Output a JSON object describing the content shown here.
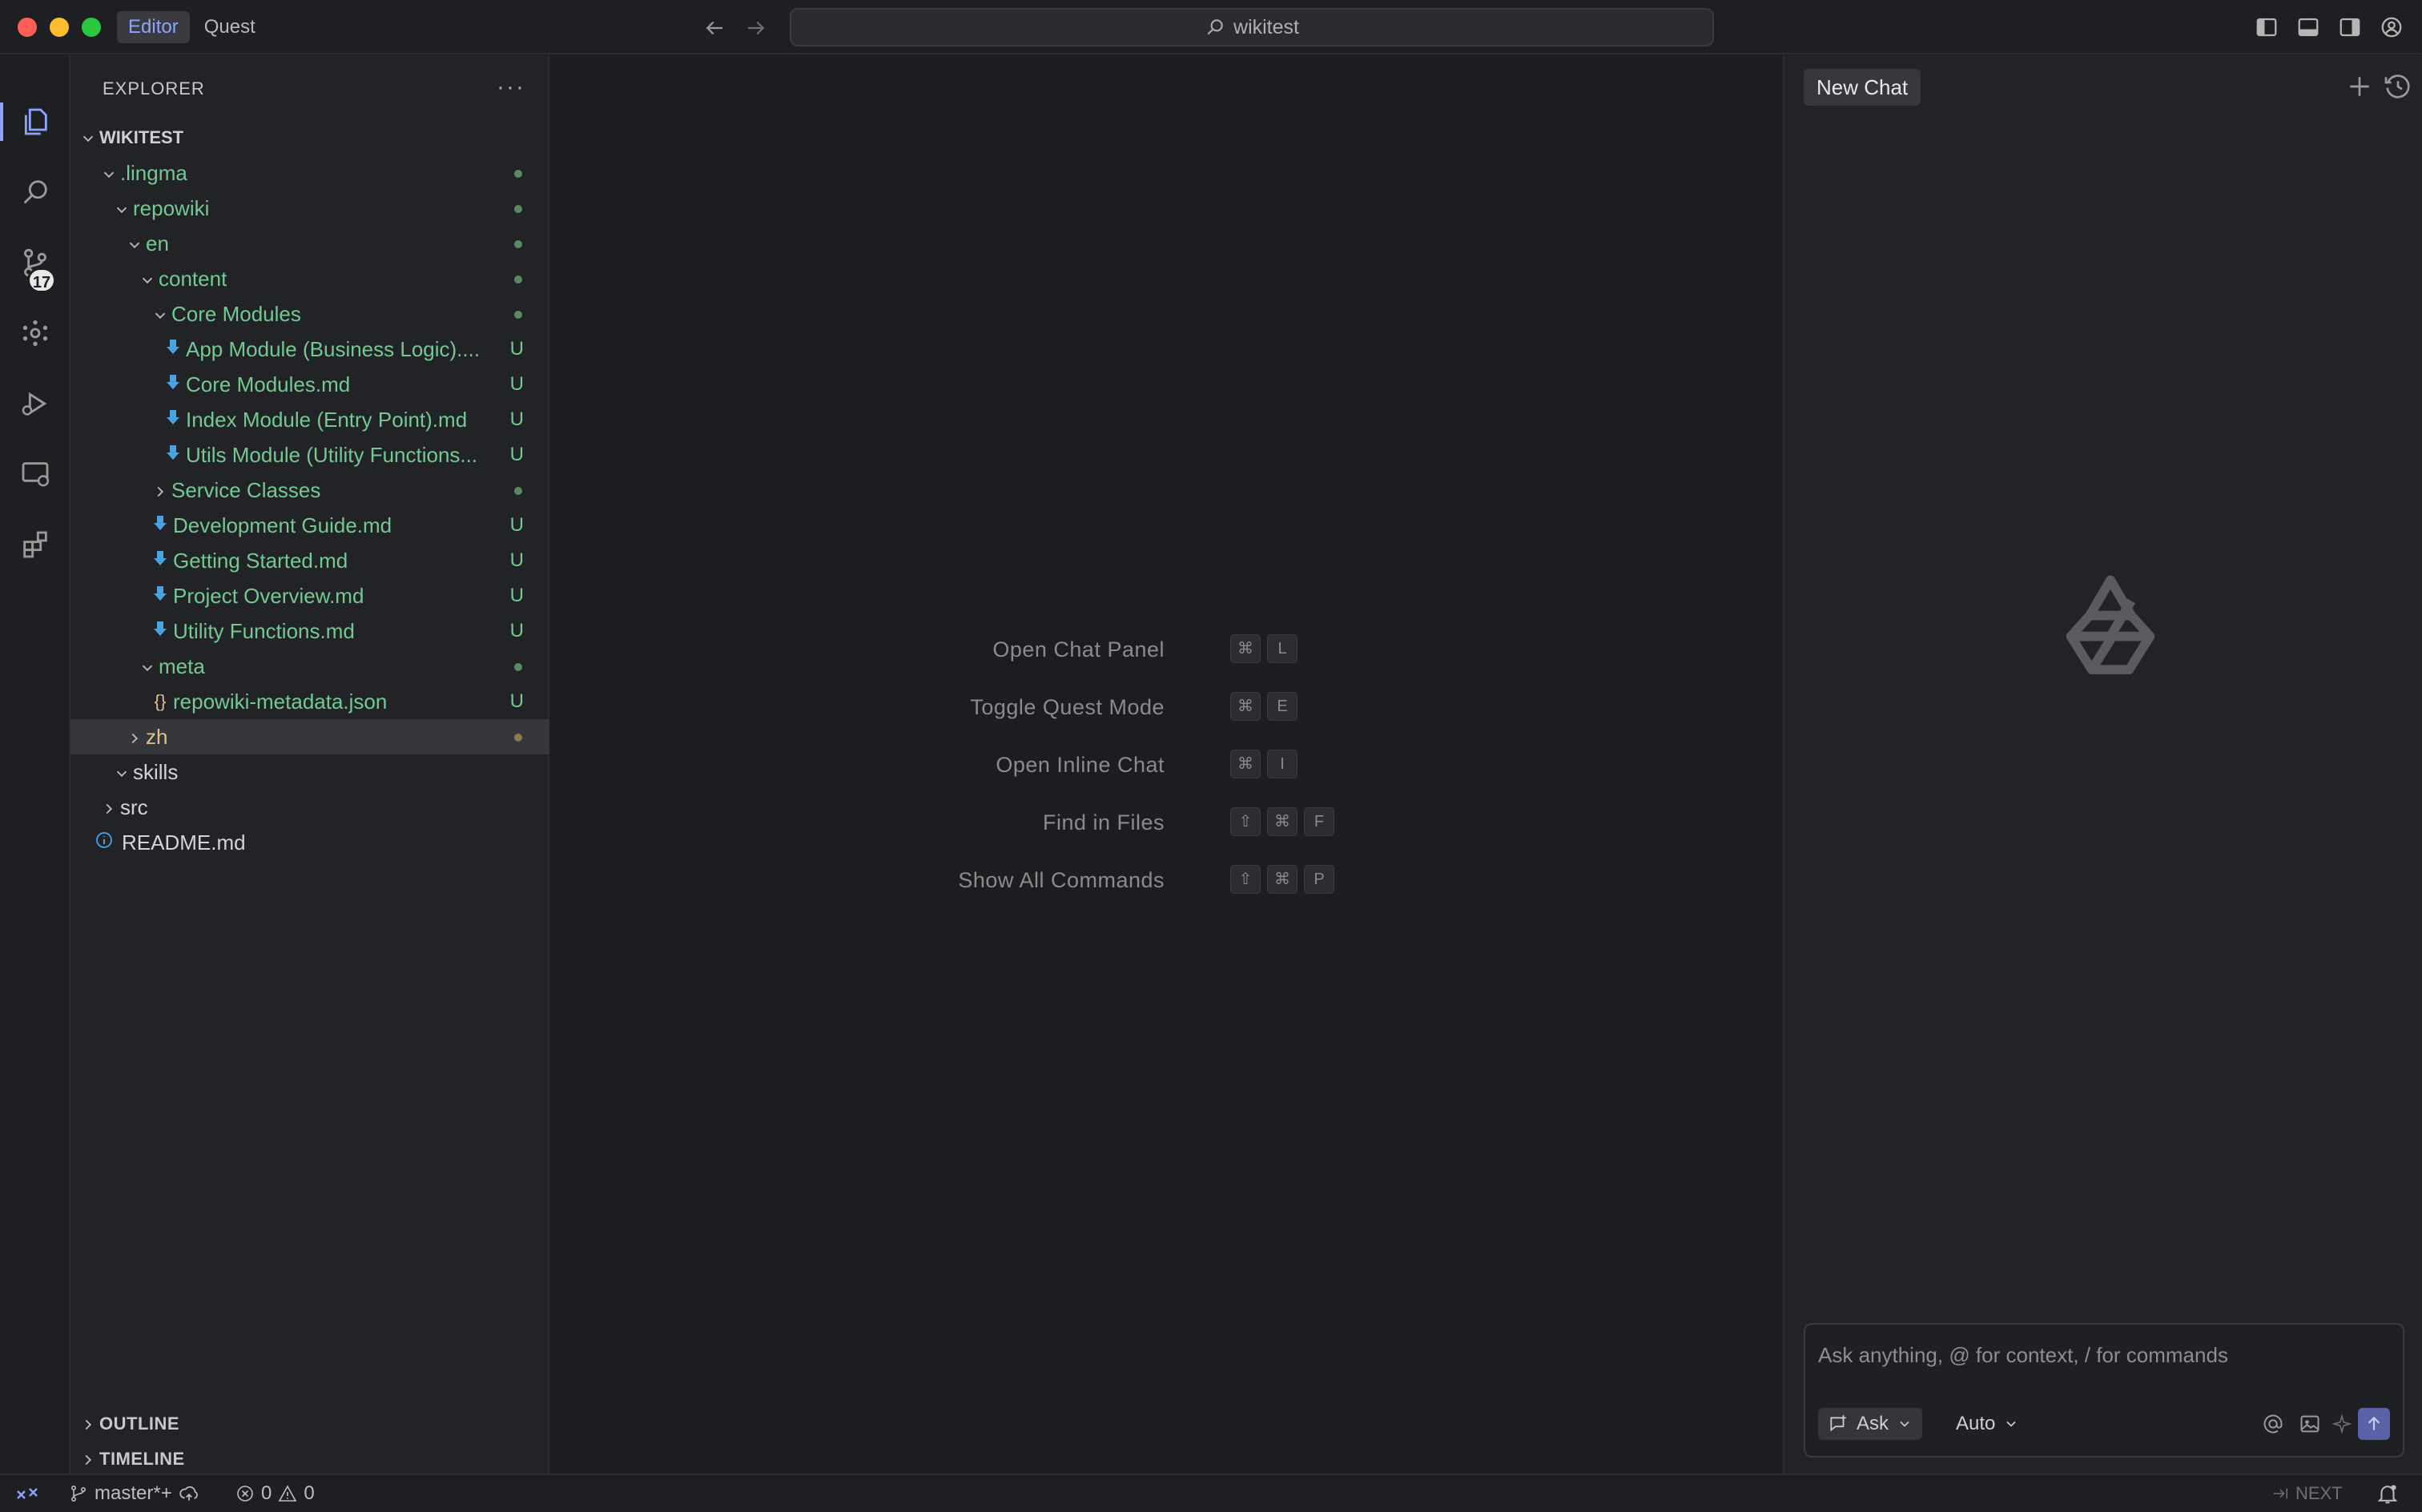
{
  "titlebar": {
    "mode_tabs": [
      "Editor",
      "Quest"
    ],
    "active_mode": "Editor",
    "search_text": "wikitest"
  },
  "activity": {
    "scm_badge": "17"
  },
  "explorer": {
    "header": "EXPLORER",
    "root": "WIKITEST",
    "items": [
      {
        "label": ".lingma",
        "status": "dot"
      },
      {
        "label": "repowiki",
        "status": "dot"
      },
      {
        "label": "en",
        "status": "dot"
      },
      {
        "label": "content",
        "status": "dot"
      },
      {
        "label": "Core Modules",
        "status": "dot"
      },
      {
        "label": "App Module (Business Logic)....",
        "status": "U"
      },
      {
        "label": "Core Modules.md",
        "status": "U"
      },
      {
        "label": "Index Module (Entry Point).md",
        "status": "U"
      },
      {
        "label": "Utils Module (Utility Functions...",
        "status": "U"
      },
      {
        "label": "Service Classes",
        "status": "dot"
      },
      {
        "label": "Development Guide.md",
        "status": "U"
      },
      {
        "label": "Getting Started.md",
        "status": "U"
      },
      {
        "label": "Project Overview.md",
        "status": "U"
      },
      {
        "label": "Utility Functions.md",
        "status": "U"
      },
      {
        "label": "meta",
        "status": "dot"
      },
      {
        "label": "repowiki-metadata.json",
        "status": "U"
      },
      {
        "label": "zh",
        "status": "dot"
      },
      {
        "label": "skills",
        "status": ""
      },
      {
        "label": "src",
        "status": ""
      },
      {
        "label": "README.md",
        "status": ""
      }
    ],
    "outline": "OUTLINE",
    "timeline": "TIMELINE"
  },
  "editor": {
    "hints": [
      {
        "label": "Open Chat Panel",
        "keys": [
          "⌘",
          "L"
        ]
      },
      {
        "label": "Toggle Quest Mode",
        "keys": [
          "⌘",
          "E"
        ]
      },
      {
        "label": "Open Inline Chat",
        "keys": [
          "⌘",
          "I"
        ]
      },
      {
        "label": "Find in Files",
        "keys": [
          "⇧",
          "⌘",
          "F"
        ]
      },
      {
        "label": "Show All Commands",
        "keys": [
          "⇧",
          "⌘",
          "P"
        ]
      }
    ]
  },
  "chat": {
    "title": "New Chat",
    "input_placeholder": "Ask anything, @ for context, / for commands",
    "mode_label": "Ask",
    "model_label": "Auto"
  },
  "statusbar": {
    "branch": "master*+",
    "errors": "0",
    "warnings": "0",
    "next_label": "NEXT"
  },
  "colors": {
    "accent": "#8ea2ff",
    "untracked_green": "#73c991",
    "json_yellow": "#e2c08d",
    "send_button": "#5a63a8"
  }
}
